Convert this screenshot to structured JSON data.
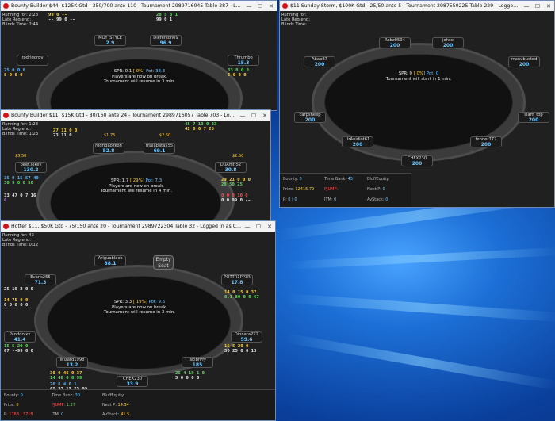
{
  "desktop": {
    "accent": "#1c6fd6"
  },
  "windows": {
    "w1": {
      "title": "Bounty Builder $44, $125K Gtd - 350/700 ante 110 - Tournament 2989716045 Table 287 - Logged In a...",
      "info": [
        "Running for: 2:28",
        "Late Reg end:",
        "Blinds Time: 2:44"
      ],
      "center": {
        "spr": "SPR: 0.1",
        "pct": "[ 0%]",
        "pot": "Pot: 38.3",
        "line2": "Players are now on break.",
        "line3": "Tournament will resume in 3 min."
      },
      "seats": [
        {
          "name": "MOY_STYLE",
          "stack": "2.9"
        },
        {
          "name": "Dieferson09",
          "stack": "96.9"
        },
        {
          "name": "rodrigorpv",
          "stack": ""
        },
        {
          "name": "Thrumbo",
          "stack": "15.3"
        }
      ],
      "huds": [
        {
          "row1": "99 0 --",
          "row2": "-- 99 0 --"
        },
        {
          "row1": "28 5 3 1",
          "row2": "99 0 1"
        },
        {
          "row1": "25 0 0 0",
          "row2": "8 0 0 0"
        },
        {
          "row1": "33 0 0 0",
          "row2": "6 0 0 0"
        }
      ]
    },
    "w2": {
      "title": "$11 Sunday Storm, $100K Gtd - 25/50 ante 5 - Tournament 2987550225 Table 229 - Logged In as CHE...",
      "info": [
        "Running for:",
        "Late Reg end:",
        "Blinds Time:"
      ],
      "center": {
        "spr": "SPR: 0",
        "pct": "[ 0%]",
        "pot": "Pot: 0",
        "line2": "Tournament will start in 1 min.",
        "line3": ""
      },
      "seats": [
        {
          "name": "Robz0504",
          "stack": "200"
        },
        {
          "name": "johce",
          "stack": "200"
        },
        {
          "name": "Abap87",
          "stack": "200"
        },
        {
          "name": "manubusted",
          "stack": "200"
        },
        {
          "name": "carpsheep",
          "stack": "200"
        },
        {
          "name": "slam_top",
          "stack": "200"
        },
        {
          "name": "UrAnidiot61",
          "stack": "200"
        },
        {
          "name": "fenner777",
          "stack": "200"
        },
        {
          "name": "CHEX230",
          "stack": "200"
        }
      ],
      "stats": [
        {
          "label": "Bounty:",
          "value": "0"
        },
        {
          "label": "Time Bank:",
          "value": "45"
        },
        {
          "label": "BluffEquity:",
          "value": ""
        },
        {
          "label": "Prize:",
          "value": "12415.79"
        },
        {
          "label": "PJUMP:",
          "value": ""
        },
        {
          "label": "Next P:",
          "value": "0"
        },
        {
          "label": "P:",
          "value": "0 | 0"
        },
        {
          "label": "ITM:",
          "value": "0"
        },
        {
          "label": "AvStack:",
          "value": "0"
        }
      ]
    },
    "w3": {
      "title": "Bounty Builder $11, $15K Gtd - 80/160 ante 24 - Tournament 2989716057 Table 703 - Logged In...",
      "info": [
        "Running for: 1:28",
        "Late Reg end:",
        "Blinds Time: 1:23"
      ],
      "center": {
        "spr": "SPR: 1.7",
        "pct": "[ 29%]",
        "pot": "Pot: 7.3",
        "line2": "Players are now on break.",
        "line3": "Tournament will resume in 4 min."
      },
      "seats": [
        {
          "name": "rodrigaozkon",
          "stack": "52.8"
        },
        {
          "name": "malabata555",
          "stack": "69.1"
        },
        {
          "name": "beet.jokey",
          "stack": "130.2"
        },
        {
          "name": "DuAmt-52",
          "stack": "30.8"
        }
      ],
      "chips": [
        "$1.75",
        "$2.50",
        "$3.50",
        "$2.50"
      ],
      "huds": [
        {
          "row1": "27 11 0 0",
          "row2": "23 11 0"
        },
        {
          "row1": "45 7 13 0 33",
          "row2": "42 6 0 7 25"
        },
        {
          "row1": "35 9 15 57 40",
          "row2": "30 9 0 0 50"
        },
        {
          "row1": "29 21 0 0 0",
          "row2": "28 50 25"
        },
        {
          "row1": "33 47 0 7 16",
          "row2": "6"
        },
        {
          "row1": "0 0 0 10 0",
          "row2": "0 0 99 0 --"
        }
      ]
    },
    "w4": {
      "title": "Hotter $11, $50K Gtd - 75/150 ante 20 - Tournament 2989722304 Table 32 - Logged In as CHEX230",
      "info": [
        "Running for: 43",
        "Late Reg end:",
        "Blinds Time: 0:12"
      ],
      "center": {
        "spr": "SPR: 3.3",
        "pct": "[ 19%]",
        "pot": "Pot: 9.6",
        "line2": "Players are now on break.",
        "line3": "Tournament will resume in 3 min."
      },
      "empty_seat": "Empty Seat",
      "seats": [
        {
          "name": "Ariguablack",
          "stack": "38.1"
        },
        {
          "name": "Evans265",
          "stack": "71.3"
        },
        {
          "name": "POTTR1PP3R",
          "stack": "17.8"
        },
        {
          "name": "Panddo'xx",
          "stack": "41.4"
        },
        {
          "name": "DionataPZZ",
          "stack": "59.6"
        },
        {
          "name": "Wizard1998",
          "stack": "13.2"
        },
        {
          "name": "lskibrPfy",
          "stack": "185"
        },
        {
          "name": "CHEX230",
          "stack": "33.9"
        }
      ],
      "huds": [
        {
          "row1": "25 19 2 0 0",
          "row2": ""
        },
        {
          "row1": "14 75 0 0",
          "row2": "0 0 0 0 0"
        },
        {
          "row1": "14 0 15 0 37",
          "row2": "8.1 80 0 0 67"
        },
        {
          "row1": "15 5 20 0",
          "row2": "67 --99 0 0"
        },
        {
          "row1": "15 5 20 0",
          "row2": "50 25 0 0 13"
        },
        {
          "row1": "30 0 46 0 37",
          "row2": "14 40 0 0 99"
        },
        {
          "row1": "26 6 4 0 1",
          "row2": "62 33 12 25 99"
        },
        {
          "row1": "26 4 19 1 0",
          "row2": "5 0 0 0 0"
        }
      ],
      "stats": [
        {
          "label": "Bounty:",
          "value": "0"
        },
        {
          "label": "Time Bank:",
          "value": "30"
        },
        {
          "label": "BluffEquity:",
          "value": ""
        },
        {
          "label": "Prize:",
          "value": "0"
        },
        {
          "label": "PJUMP:",
          "value": "1.37"
        },
        {
          "label": "Next P:",
          "value": "14.34"
        },
        {
          "label": "P:",
          "value": "1768 | 3718"
        },
        {
          "label": "ITM:",
          "value": "0"
        },
        {
          "label": "AvStack:",
          "value": "41.5"
        }
      ]
    }
  },
  "window_buttons": {
    "min": "—",
    "max": "☐",
    "close": "✕"
  }
}
